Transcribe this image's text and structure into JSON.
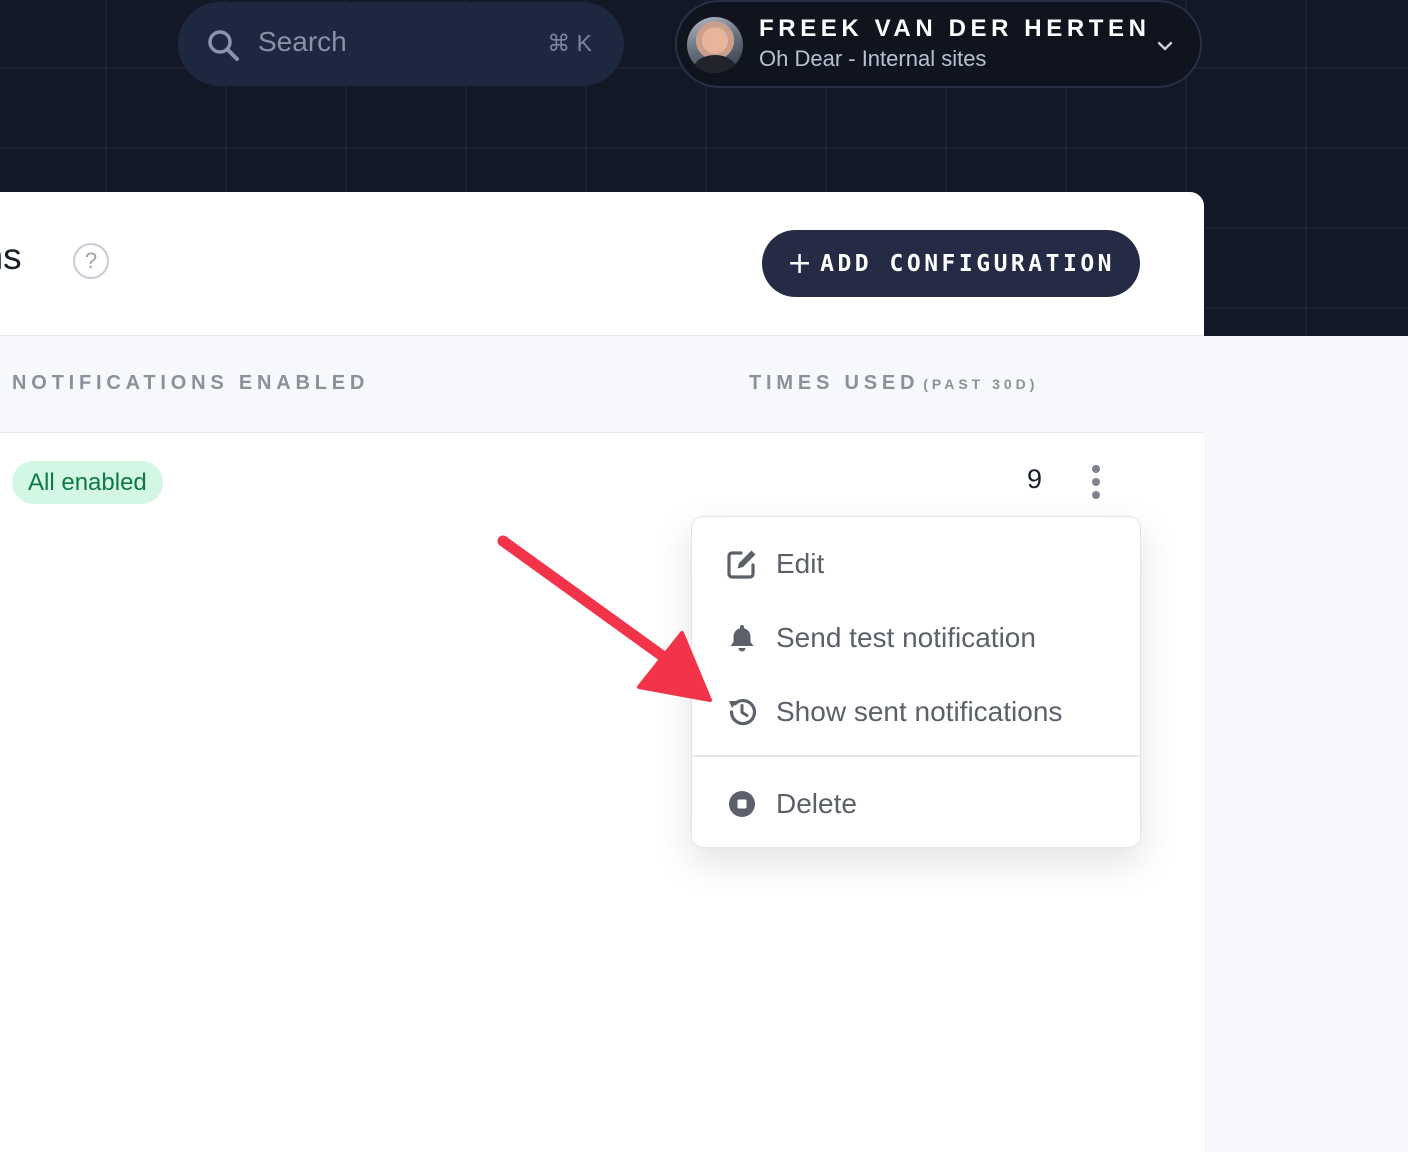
{
  "header": {
    "search": {
      "placeholder": "Search",
      "shortcut": "⌘ K"
    },
    "user": {
      "name": "FREEK VAN DER HERTEN",
      "team": "Oh Dear - Internal sites"
    }
  },
  "page": {
    "title": "ons",
    "help_glyph": "?",
    "add_button": {
      "plus": "+",
      "label": "ADD CONFIGURATION"
    }
  },
  "table": {
    "columns": {
      "notifications": "NOTIFICATIONS ENABLED",
      "times_used": "TIMES USED",
      "times_used_sub": "(PAST 30D)"
    },
    "rows": [
      {
        "status": "All enabled",
        "times_used": "9"
      }
    ]
  },
  "menu": {
    "items": [
      {
        "label": "Edit",
        "icon": "edit-icon"
      },
      {
        "label": "Send test notification",
        "icon": "bell-icon"
      },
      {
        "label": "Show sent notifications",
        "icon": "history-icon"
      },
      {
        "label": "Delete",
        "icon": "stop-circle-icon"
      }
    ]
  },
  "colors": {
    "header_bg": "#131827",
    "button_bg": "#252b45",
    "badge_bg": "#d4f6e4",
    "badge_text": "#0d7a45",
    "annotation_arrow": "#f2334a"
  }
}
